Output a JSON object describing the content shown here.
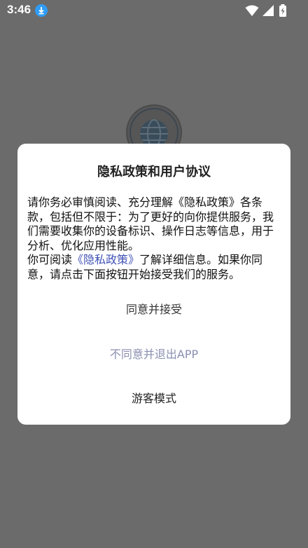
{
  "status_bar": {
    "time": "3:46",
    "icons": [
      "download-icon",
      "wifi-icon",
      "signal-icon",
      "battery-icon"
    ]
  },
  "background": {
    "logo_icon": "organization-globe-logo"
  },
  "dialog": {
    "title": "隐私政策和用户协议",
    "paragraph1": "请你务必审慎阅读、充分理解《隐私政策》各条款，包括但不限于：为了更好的向你提供服务，我们需要收集你的设备标识、操作日志等信息，用于分析、优化应用性能。",
    "paragraph2_prefix": "你可阅读",
    "policy_link": "《隐私政策》",
    "paragraph2_suffix": "了解详细信息。如果你同意，请点击下面按钮开始接受我们的服务。",
    "accept_label": "同意并接受",
    "decline_label": "不同意并退出APP",
    "guest_label": "游客模式"
  },
  "colors": {
    "overlay": "#6b6b6b",
    "dialog_bg": "#ffffff",
    "link": "#3f51b5",
    "decline_text": "#8a8fb0",
    "download_badge": "#2f9cf5"
  }
}
